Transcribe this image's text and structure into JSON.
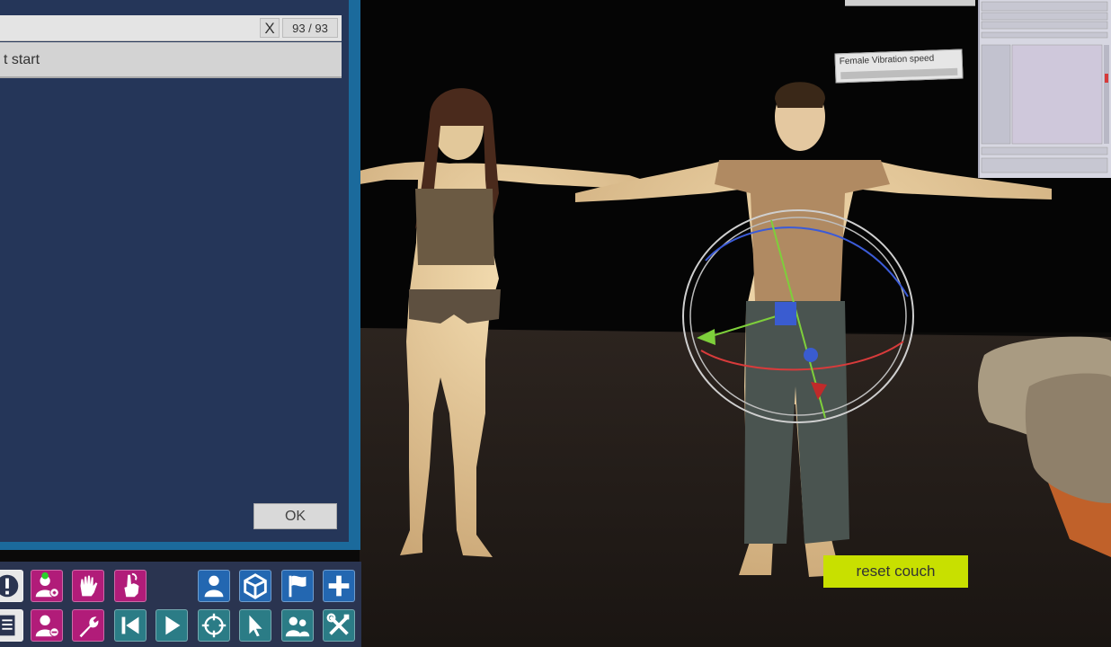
{
  "dialog": {
    "counter": "93 / 93",
    "clear_label": "X",
    "result_item": "t start",
    "ok_label": "OK"
  },
  "scene": {
    "vibration_label": "Female Vibration speed",
    "reset_label": "reset couch"
  },
  "toolbar": {
    "row1": [
      "alert-icon",
      "add-person-icon",
      "hand-icon",
      "pointer-hand-icon",
      "person-icon",
      "unity-icon",
      "flag-icon",
      "plus-icon"
    ],
    "row2": [
      "document-icon",
      "remove-person-icon",
      "wrench-person-icon",
      "skip-back-icon",
      "play-icon",
      "crosshair-icon",
      "cursor-icon",
      "group-icon",
      "tools-icon"
    ]
  },
  "colors": {
    "dialog_bg": "#253659",
    "dialog_border": "#1b6a9c",
    "accent_yellow": "#c8e000",
    "magenta": "#b11c79",
    "teal": "#2b7c86",
    "blue": "#2367b1"
  }
}
